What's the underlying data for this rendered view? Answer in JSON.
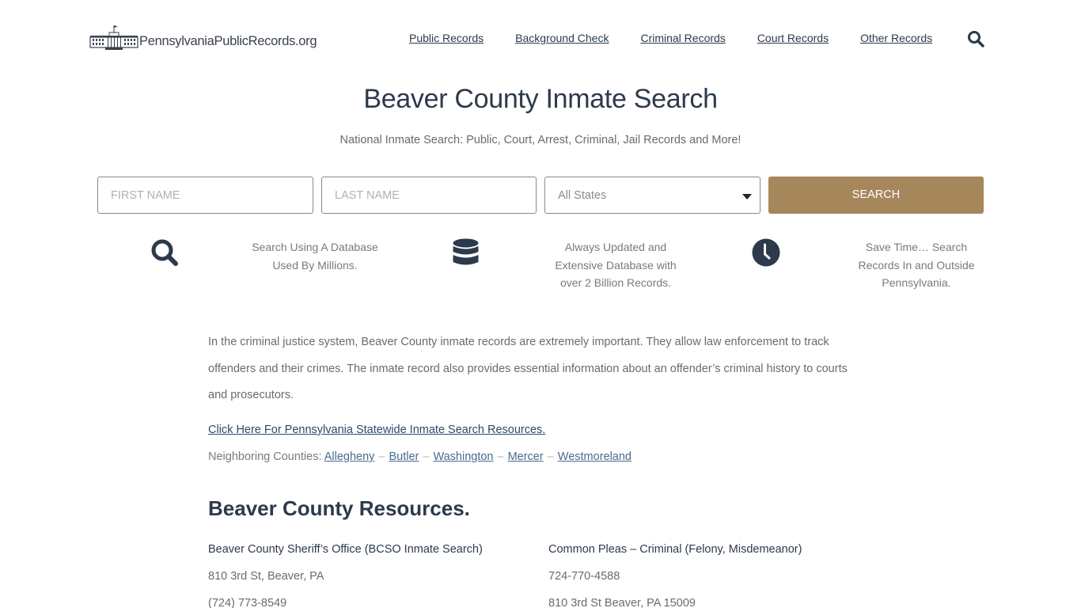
{
  "header": {
    "logo_text": "PennsylvaniaPublicRecords.org",
    "nav": [
      {
        "label": "Public Records"
      },
      {
        "label": "Background Check"
      },
      {
        "label": "Criminal Records"
      },
      {
        "label": "Court Records"
      },
      {
        "label": "Other Records"
      }
    ],
    "search_icon": "search-icon"
  },
  "hero": {
    "title": "Beaver County Inmate Search",
    "subtitle": "National Inmate Search: Public, Court, Arrest, Criminal, Jail Records and More!"
  },
  "search_form": {
    "first_name_placeholder": "FIRST NAME",
    "first_name_value": "",
    "last_name_placeholder": "LAST NAME",
    "last_name_value": "",
    "state_selected": "All States",
    "search_button": "SEARCH"
  },
  "features": [
    {
      "icon": "search-icon",
      "text_line1": "Search Using A Database",
      "text_line2": "Used By Millions.",
      "text_line3": ""
    },
    {
      "icon": "database-icon",
      "text_line1": "Always Updated and",
      "text_line2": "Extensive Database with",
      "text_line3": "over 2 Billion Records."
    },
    {
      "icon": "clock-icon",
      "text_line1": "Save Time… Search",
      "text_line2": "Records In and Outside",
      "text_line3": "Pennsylvania."
    }
  ],
  "content": {
    "intro": "In the criminal justice system, Beaver County inmate records are extremely important. They allow law enforcement to track offenders and their crimes. The inmate record also provides essential information about an offender’s criminal history to courts and prosecutors.",
    "statewide_link": "Click Here For Pennsylvania Statewide Inmate Search Resources.",
    "neighbors_label": "Neighboring Counties:",
    "neighbors": [
      "Allegheny",
      "Butler",
      "Washington",
      "Mercer",
      "Westmoreland"
    ],
    "separator": "–"
  },
  "resources": {
    "title": "Beaver County Resources.",
    "items": [
      {
        "name": "Beaver County Sheriff’s Office (BCSO Inmate Search)",
        "line1": "810 3rd St, Beaver, PA",
        "line2": "(724) 773-8549"
      },
      {
        "name": "Common Pleas – Criminal (Felony, Misdemeanor)",
        "line1": "724-770-4588",
        "line2": "810 3rd St Beaver, PA 15009"
      }
    ]
  },
  "colors": {
    "primary_text": "#2d3a4b",
    "accent_button": "#a6865b",
    "muted_text": "#6b6b6b"
  }
}
